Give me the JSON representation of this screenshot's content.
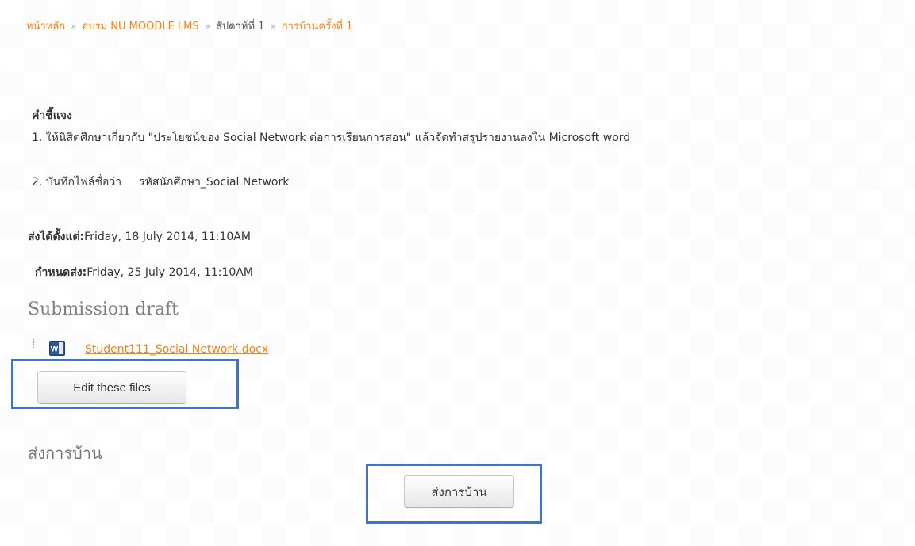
{
  "breadcrumb": {
    "home": "หน้าหลัก",
    "course": "อบรม NU MOODLE LMS",
    "week": "สัปดาห์ที่ 1",
    "assignment": "การบ้านครั้งที่ 1",
    "separator": "»"
  },
  "intro": {
    "heading": "คำชี้แจง",
    "line1": "1. ให้นิสิตศึกษาเกี่ยวกับ \"ประโยชน์ของ Social Network ต่อการเรียนการสอน\"  แล้วจัดทำสรุปรายงานลงใน Microsoft word",
    "line2_prefix": "2. บันทึกไฟล์ชื่อว่า",
    "line2_value": "รหัสนักศึกษา_Social Network"
  },
  "dates": {
    "allow_label": "ส่งได้ตั้งแต่:",
    "allow_value": "Friday, 18 July 2014, 11:10AM",
    "due_label": "กำหนดส่ง:",
    "due_value": "Friday, 25 July 2014, 11:10AM"
  },
  "submission": {
    "title": "Submission draft",
    "file_name": "Student111_Social Network.docx",
    "file_icon": "word-document-icon",
    "edit_button": "Edit these files"
  },
  "submit": {
    "heading": "ส่งการบ้าน",
    "button": "ส่งการบ้าน"
  },
  "colors": {
    "link": "#f98012",
    "highlight": "#4472c4",
    "muted_heading": "#777777"
  }
}
